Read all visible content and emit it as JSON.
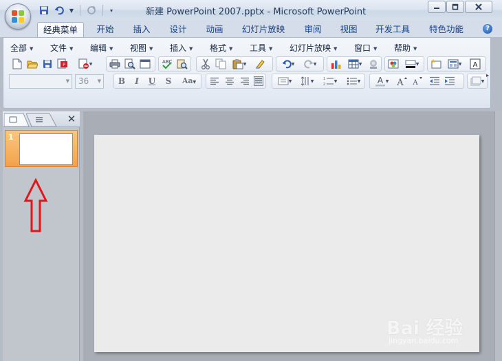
{
  "window": {
    "title": "新建 PowerPoint 2007.pptx - Microsoft PowerPoint"
  },
  "ribbon_tabs": [
    "经典菜单",
    "开始",
    "插入",
    "设计",
    "动画",
    "幻灯片放映",
    "审阅",
    "视图",
    "开发工具",
    "特色功能"
  ],
  "active_tab": "经典菜单",
  "classic_menu": [
    "全部",
    "文件",
    "编辑",
    "视图",
    "插入",
    "格式",
    "工具",
    "幻灯片放映",
    "窗口",
    "帮助"
  ],
  "format_bar": {
    "font_name": "",
    "font_size": "36"
  },
  "slides_pane": {
    "thumbnails": [
      {
        "number": "1",
        "selected": true
      }
    ]
  },
  "watermark": {
    "logo": "Bai 经验",
    "url": "jingyan.baidu.com"
  },
  "colors": {
    "selection_orange": "#f2a24a",
    "annotation_red": "#e0161c",
    "ribbon_blue": "#15428b"
  }
}
